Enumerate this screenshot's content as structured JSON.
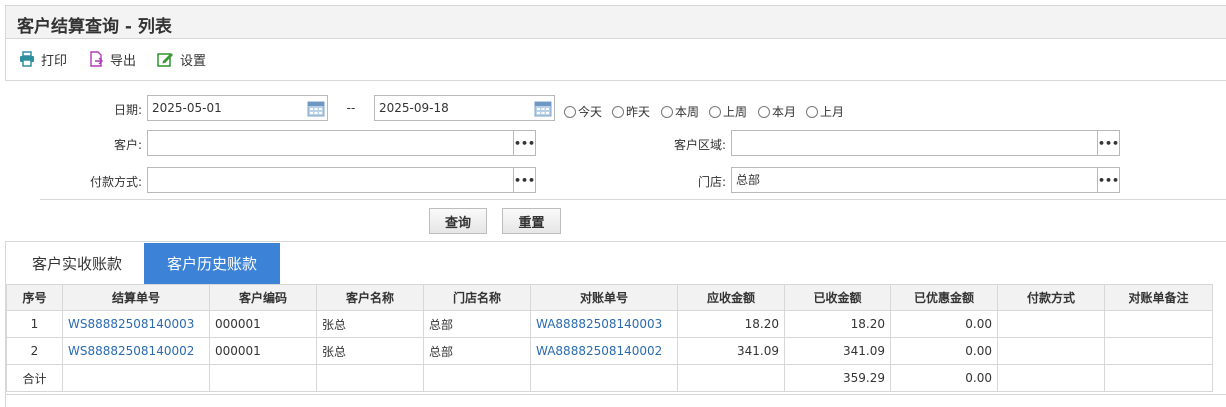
{
  "title": "客户结算查询 - 列表",
  "toolbar": {
    "print": "打印",
    "export": "导出",
    "settings": "设置"
  },
  "filters": {
    "date_label": "日期:",
    "date_from": "2025-05-01",
    "date_sep": "--",
    "date_to": "2025-09-18",
    "quick_ranges": [
      "今天",
      "昨天",
      "本周",
      "上周",
      "本月",
      "上月"
    ],
    "customer_label": "客户:",
    "customer_value": "",
    "region_label": "客户区域:",
    "region_value": "",
    "payment_label": "付款方式:",
    "payment_value": "",
    "store_label": "门店:",
    "store_value": "总部",
    "dots": "•••",
    "query_button": "查询",
    "reset_button": "重置"
  },
  "tabs": [
    {
      "label": "客户实收账款",
      "active": false
    },
    {
      "label": "客户历史账款",
      "active": true
    }
  ],
  "table": {
    "columns": [
      "序号",
      "结算单号",
      "客户编码",
      "客户名称",
      "门店名称",
      "对账单号",
      "应收金额",
      "已收金额",
      "已优惠金额",
      "付款方式",
      "对账单备注"
    ],
    "rows": [
      {
        "no": "1",
        "settle_no": "WS88882508140003",
        "cust_code": "000001",
        "cust_name": "张总",
        "store": "总部",
        "recon_no": "WA88882508140003",
        "receivable": "18.20",
        "received": "18.20",
        "discount": "0.00",
        "payment": "",
        "remark": ""
      },
      {
        "no": "2",
        "settle_no": "WS88882508140002",
        "cust_code": "000001",
        "cust_name": "张总",
        "store": "总部",
        "recon_no": "WA88882508140002",
        "receivable": "341.09",
        "received": "341.09",
        "discount": "0.00",
        "payment": "",
        "remark": ""
      }
    ],
    "total": {
      "label": "合计",
      "received": "359.29",
      "discount": "0.00"
    }
  },
  "colors": {
    "accent": "#3c82d6",
    "link": "#2a6bb0",
    "print_icon": "#2f8fa0",
    "export_icon": "#b03ab8",
    "settings_icon": "#3a9a3a"
  }
}
